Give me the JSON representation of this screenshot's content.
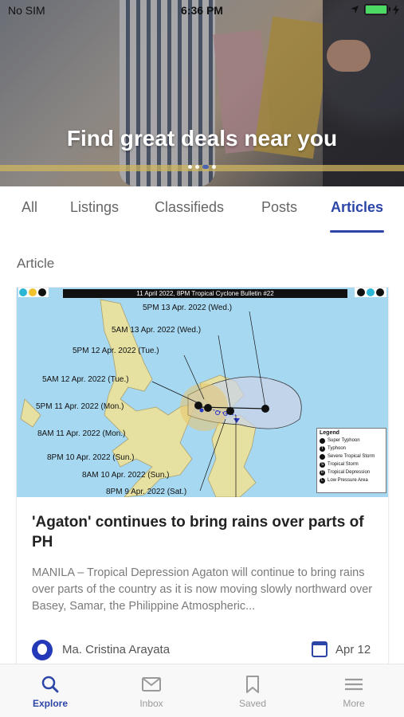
{
  "status_bar": {
    "carrier": "No SIM",
    "time": "6:36 PM",
    "battery_level": 1.0,
    "battery_color": "#4cd964"
  },
  "hero": {
    "title": "Find great deals near you",
    "slides": 3,
    "active_slide": 2
  },
  "tabs": [
    {
      "label": "All",
      "active": false
    },
    {
      "label": "Listings",
      "active": false
    },
    {
      "label": "Classifieds",
      "active": false
    },
    {
      "label": "Posts",
      "active": false
    },
    {
      "label": "Articles",
      "active": true
    }
  ],
  "section_label": "Article",
  "article": {
    "image": {
      "header": "11 April 2022, 8PM Tropical Cyclone Bulletin #22",
      "track_labels": [
        "5PM 13 Apr. 2022 (Wed.)",
        "5AM 13 Apr. 2022 (Wed.)",
        "5PM 12 Apr. 2022 (Tue.)",
        "5AM 12 Apr. 2022 (Tue.)",
        "5PM 11 Apr. 2022 (Mon.)",
        "8AM 11 Apr. 2022 (Mon.)",
        "8PM 10 Apr. 2022 (Sun.)",
        "8AM 10 Apr. 2022 (Sun.)",
        "8PM 9 Apr. 2022 (Sat.)"
      ],
      "legend": {
        "title": "Legend",
        "items": [
          {
            "symbol": "",
            "label": "Super Typhoon"
          },
          {
            "symbol": "T",
            "label": "Typhoon"
          },
          {
            "symbol": "",
            "label": "Severe Tropical Storm"
          },
          {
            "symbol": "S",
            "label": "Tropical Storm"
          },
          {
            "symbol": "D",
            "label": "Tropical Depression"
          },
          {
            "symbol": "L",
            "label": "Low Pressure Area"
          }
        ]
      }
    },
    "title": "'Agaton' continues to bring rains over parts of PH",
    "excerpt": "MANILA – Tropical Depression Agaton will continue to bring rains over parts of the country as it is now moving slowly northward over Basey, Samar, the Philippine Atmospheric...",
    "author": "Ma. Cristina Arayata",
    "date": "Apr 12"
  },
  "bottom_nav": [
    {
      "label": "Explore",
      "icon": "search-icon",
      "active": true
    },
    {
      "label": "Inbox",
      "icon": "mail-icon",
      "active": false
    },
    {
      "label": "Saved",
      "icon": "bookmark-icon",
      "active": false
    },
    {
      "label": "More",
      "icon": "menu-icon",
      "active": false
    }
  ],
  "colors": {
    "accent": "#2c46a8",
    "muted_text": "#7a7a7a"
  }
}
